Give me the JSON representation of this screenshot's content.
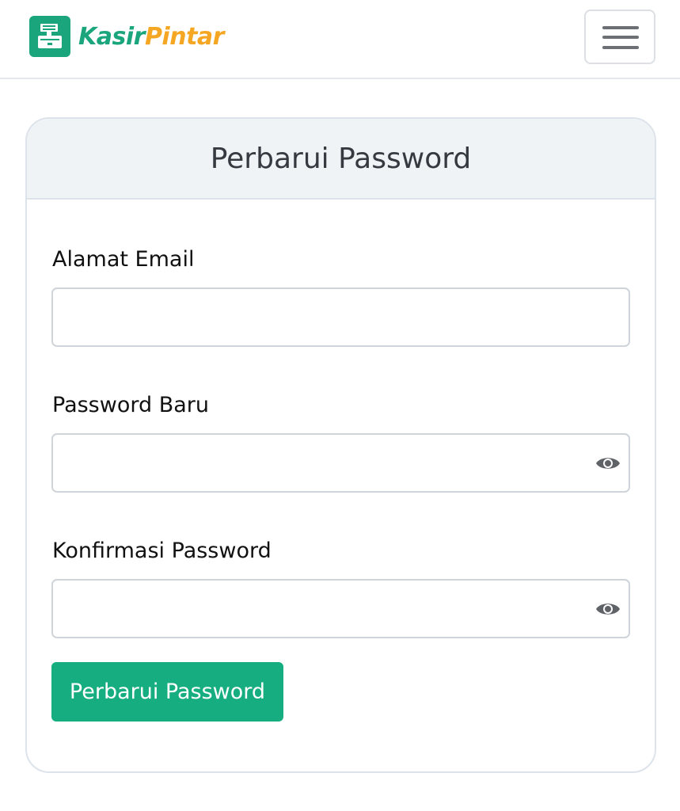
{
  "navbar": {
    "brand": {
      "part1": "Kasir",
      "part2": "Pintar",
      "logo_icon": "cash-register-icon"
    },
    "toggle_icon": "hamburger-menu-icon"
  },
  "card": {
    "title": "Perbarui Password"
  },
  "form": {
    "email": {
      "label": "Alamat Email",
      "value": "",
      "placeholder": ""
    },
    "new_password": {
      "label": "Password Baru",
      "value": "",
      "placeholder": "",
      "toggle_icon": "eye-icon"
    },
    "confirm_password": {
      "label": "Konfirmasi Password",
      "value": "",
      "placeholder": "",
      "toggle_icon": "eye-icon"
    },
    "submit_label": "Perbarui Password"
  },
  "colors": {
    "brand_green": "#1aa57d",
    "brand_orange": "#f5a623",
    "button_green": "#16ad80",
    "header_bg": "#f0f3f6"
  }
}
